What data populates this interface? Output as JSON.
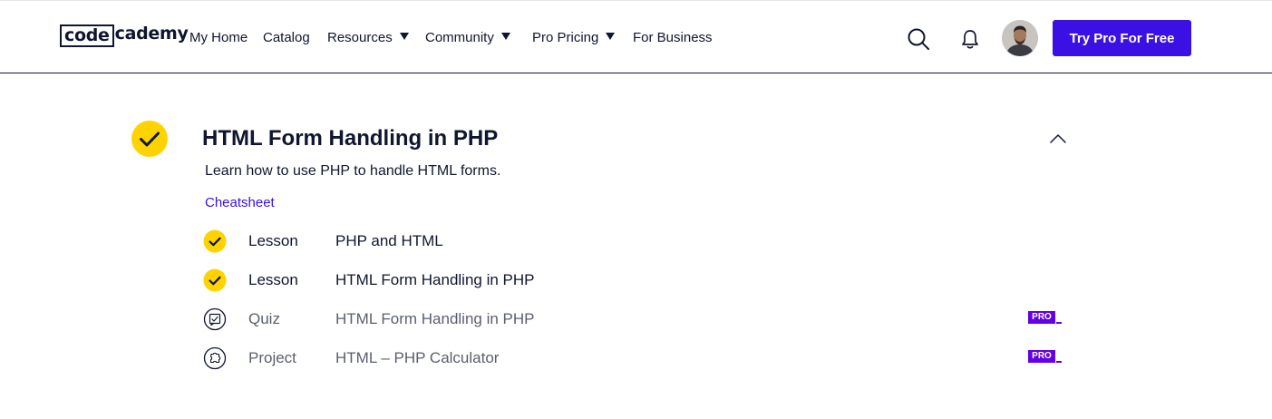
{
  "header": {
    "logo": {
      "box_text": "code",
      "rest_text": "cademy"
    },
    "nav": [
      {
        "label": "My Home",
        "has_dropdown": false
      },
      {
        "label": "Catalog",
        "has_dropdown": false
      },
      {
        "label": "Resources",
        "has_dropdown": true
      },
      {
        "label": "Community",
        "has_dropdown": true
      },
      {
        "label": "Pro Pricing",
        "has_dropdown": true
      },
      {
        "label": "For Business",
        "has_dropdown": false
      }
    ],
    "icons": {
      "search": "search-icon",
      "notifications": "bell-icon",
      "avatar": "user-avatar"
    },
    "cta_label": "Try Pro For Free",
    "colors": {
      "accent": "#3a10e5",
      "ink": "#10162f"
    }
  },
  "module": {
    "title": "HTML Form Handling in PHP",
    "description": "Learn how to use PHP to handle HTML forms.",
    "cheatsheet_label": "Cheatsheet",
    "completed": true,
    "expanded": true,
    "colors": {
      "complete": "#ffd300",
      "pro": "#6400e4",
      "link": "#3a10e5"
    },
    "items": [
      {
        "type": "Lesson",
        "name": "PHP and HTML",
        "status": "completed",
        "icon": "check-icon",
        "pro": false
      },
      {
        "type": "Lesson",
        "name": "HTML Form Handling in PHP",
        "status": "completed",
        "icon": "check-icon",
        "pro": false
      },
      {
        "type": "Quiz",
        "name": "HTML Form Handling in PHP",
        "status": "locked",
        "icon": "quiz-icon",
        "pro": true,
        "pro_label": "PRO"
      },
      {
        "type": "Project",
        "name": "HTML – PHP Calculator",
        "status": "locked",
        "icon": "project-icon",
        "pro": true,
        "pro_label": "PRO"
      }
    ]
  }
}
